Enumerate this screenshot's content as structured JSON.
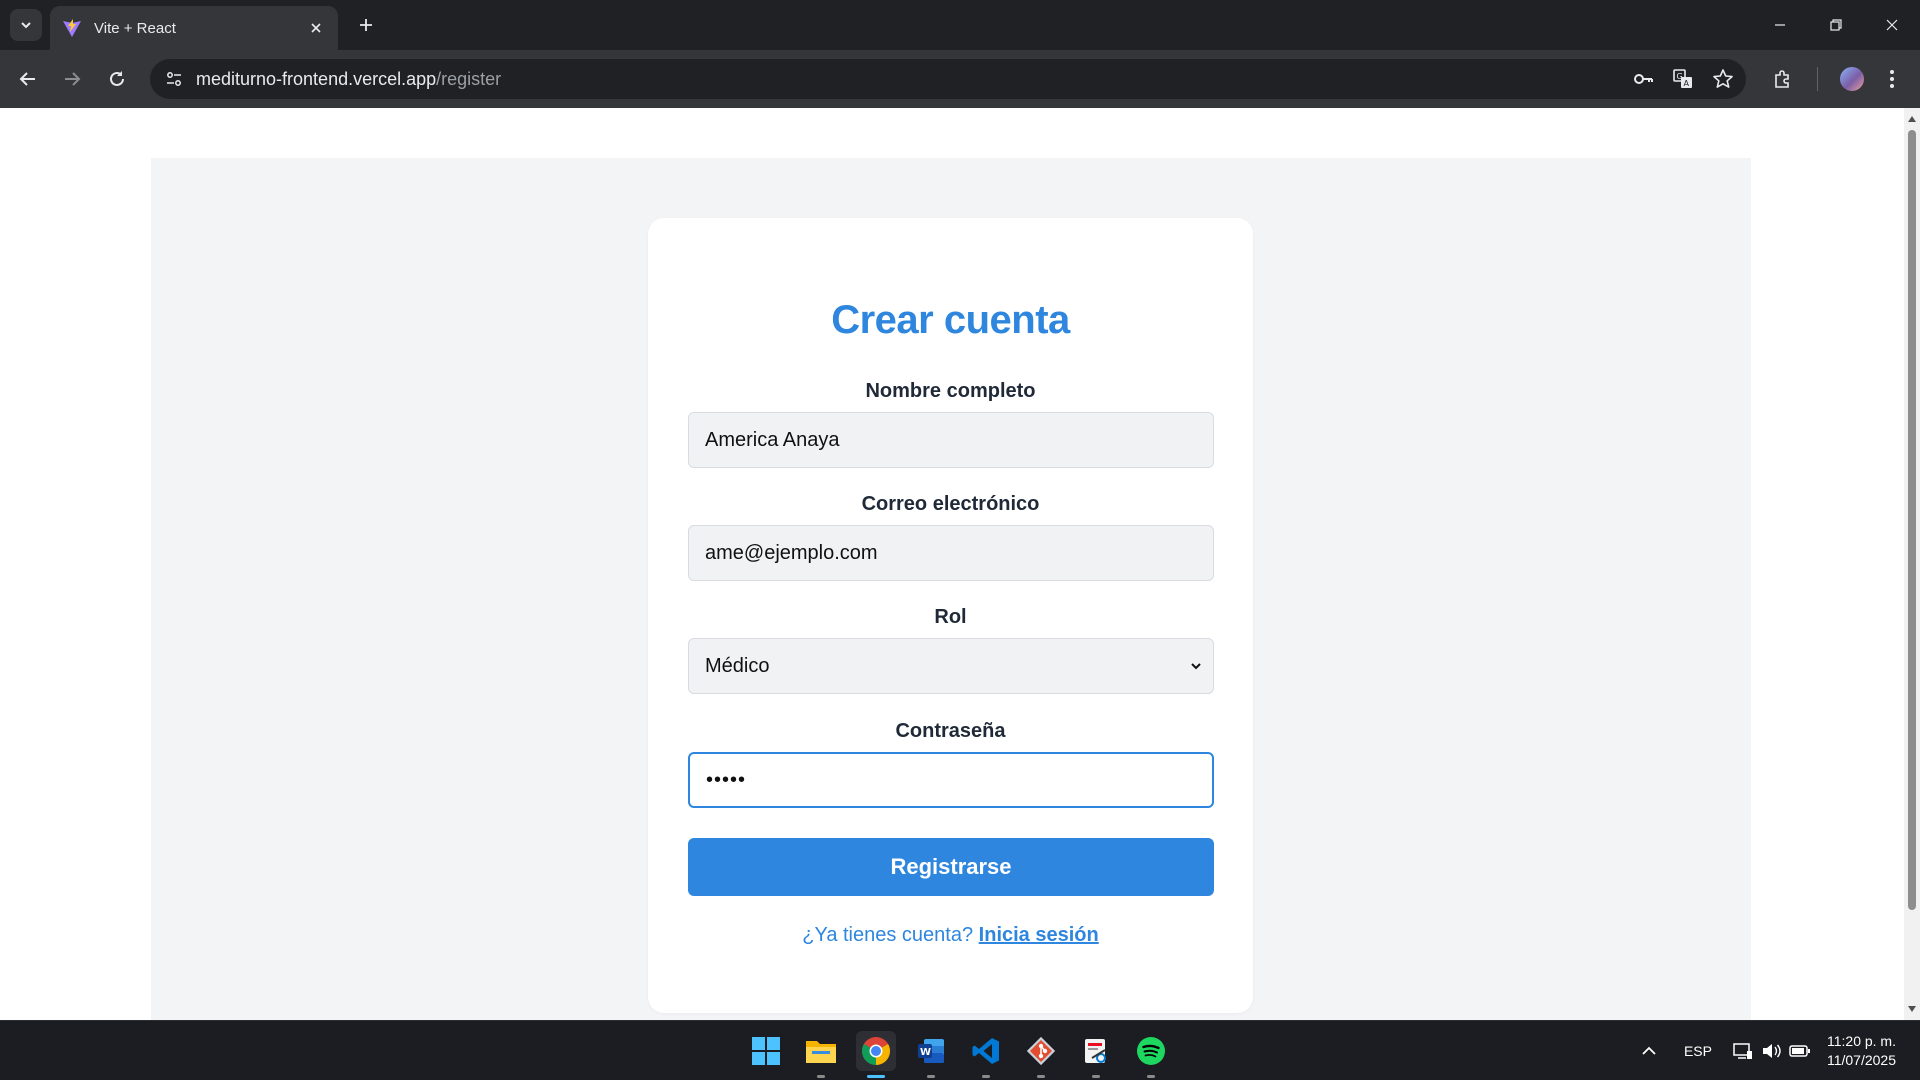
{
  "browser": {
    "tab_title": "Vite + React",
    "url_host": "mediturno-frontend.vercel.app",
    "url_path": "/register",
    "icons": [
      "tab-search-icon",
      "vite-favicon-icon",
      "close-icon",
      "plus-icon",
      "minimize-icon",
      "restore-icon",
      "close-window-icon",
      "back-icon",
      "forward-icon",
      "reload-icon",
      "site-info-icon",
      "password-key-icon",
      "translate-icon",
      "bookmark-star-icon",
      "extensions-icon",
      "kebab-menu-icon"
    ]
  },
  "form": {
    "title": "Crear cuenta",
    "name_label": "Nombre completo",
    "name_value": "America Anaya",
    "email_label": "Correo electrónico",
    "email_value": "ame@ejemplo.com",
    "role_label": "Rol",
    "role_value": "Médico",
    "password_label": "Contraseña",
    "password_mask": "•••••",
    "submit_label": "Registrarse",
    "login_prompt": "¿Ya tienes cuenta?",
    "login_link": "Inicia sesión"
  },
  "colors": {
    "accent": "#2e86de",
    "page_background": "#f3f4f6",
    "card_background": "#ffffff"
  },
  "taskbar": {
    "apps": [
      "start",
      "file-explorer",
      "chrome",
      "word",
      "vscode",
      "git",
      "snipping-tool",
      "spotify"
    ],
    "language": "ESP",
    "time": "11:20 p. m.",
    "date": "11/07/2025"
  }
}
